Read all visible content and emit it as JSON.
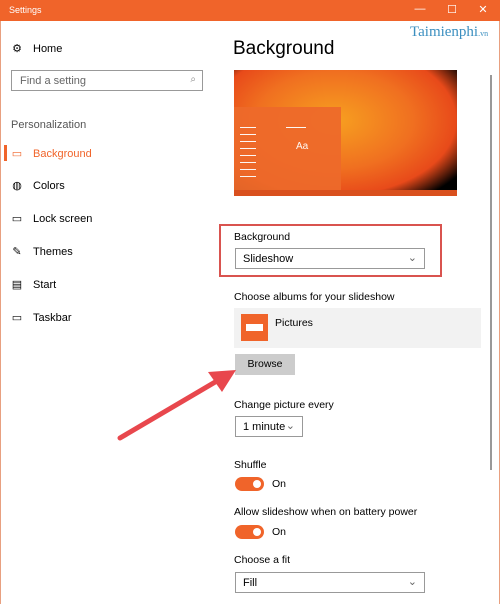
{
  "window": {
    "title": "Settings",
    "controls": [
      "minimize",
      "maximize",
      "close"
    ]
  },
  "watermark": "Taimienphi.vn",
  "sidebar": {
    "home": "Home",
    "search_placeholder": "Find a setting",
    "section": "Personalization",
    "items": [
      {
        "label": "Background",
        "icon": "image-icon",
        "selected": true
      },
      {
        "label": "Colors",
        "icon": "palette-icon"
      },
      {
        "label": "Lock screen",
        "icon": "lock-screen-icon"
      },
      {
        "label": "Themes",
        "icon": "themes-icon"
      },
      {
        "label": "Start",
        "icon": "start-icon"
      },
      {
        "label": "Taskbar",
        "icon": "taskbar-icon"
      }
    ]
  },
  "main": {
    "title": "Background",
    "preview_text": "Aa",
    "background_label": "Background",
    "background_value": "Slideshow",
    "albums_label": "Choose albums for your slideshow",
    "album": "Pictures",
    "browse": "Browse",
    "change_label": "Change picture every",
    "change_value": "1 minute",
    "shuffle_label": "Shuffle",
    "shuffle_state": "On",
    "battery_label": "Allow slideshow when on battery power",
    "battery_state": "On",
    "fit_label": "Choose a fit",
    "fit_value": "Fill"
  },
  "colors": {
    "accent": "#f0642a",
    "highlight": "#d9534f",
    "arrow": "#e8474d"
  }
}
